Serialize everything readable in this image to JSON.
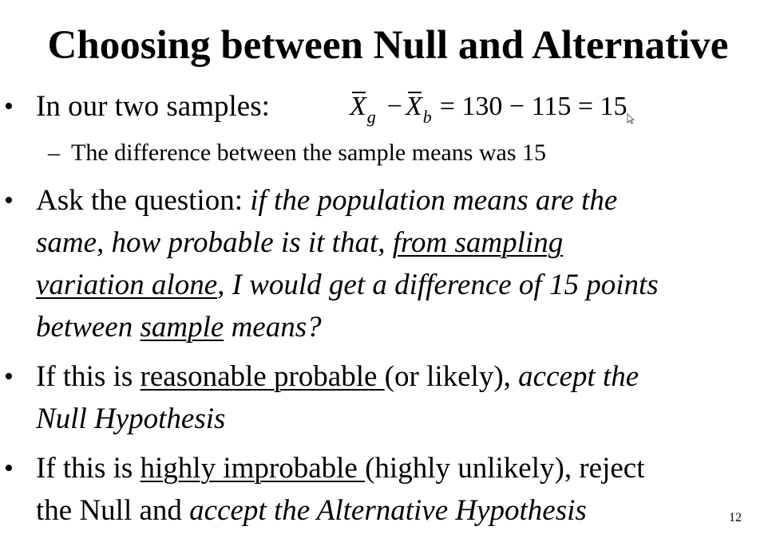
{
  "slide": {
    "title": "Choosing between Null and Alternative",
    "page_number": "12"
  },
  "bullets": {
    "b1": {
      "text": "In our two samples:",
      "formula": {
        "mean1_symbol": "X",
        "mean1_subscript": "g",
        "minus": "−",
        "mean2_symbol": "X",
        "mean2_subscript": "b",
        "rest": "= 130 − 115 = 15"
      },
      "sub": "The difference between the sample means was 15"
    },
    "b2": {
      "line1_a": "Ask the question: ",
      "line1_b": "if the population means are the",
      "line2_a": "same, how probable is it that, ",
      "line2_b": "from sampling",
      "line3_a": "variation alone",
      "line3_b": ", I would get a difference of 15 points",
      "line4_a": "between ",
      "line4_b": "sample",
      "line4_c": " means?"
    },
    "b3": {
      "line1_a": "If this is ",
      "line1_b": "reasonable probable ",
      "line1_c": "(or likely), ",
      "line1_d": "accept the",
      "line2": "Null Hypothesis"
    },
    "b4": {
      "line1_a": "If this is ",
      "line1_b": "highly improbable ",
      "line1_c": "(highly unlikely), reject",
      "line2_a": "the Null and ",
      "line2_b": "accept the Alternative Hypothesis"
    },
    "bullet_symbol": "•",
    "dash_symbol": "–"
  }
}
